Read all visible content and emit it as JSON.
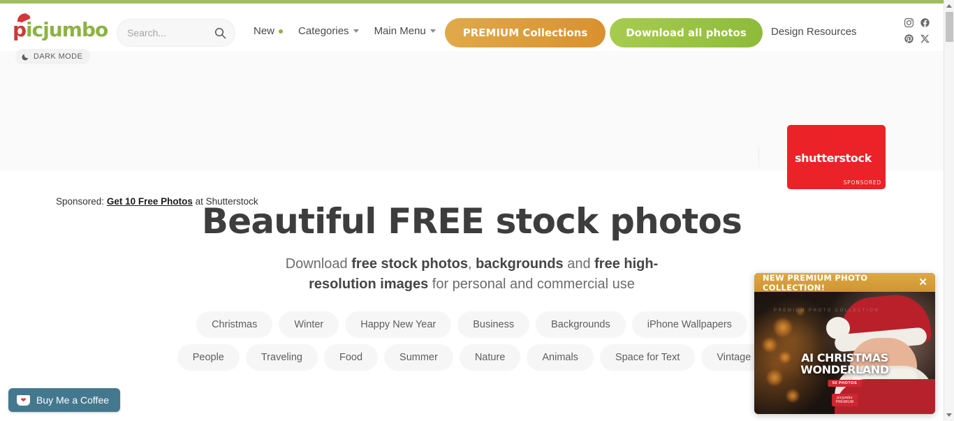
{
  "site": {
    "logo_text_first": "p",
    "logo_text_rest": "icjumbo",
    "accent_green": "#8cb342",
    "accent_gold": "#d9912f",
    "accent_red": "#eb2227"
  },
  "header": {
    "search": {
      "placeholder": "Search...",
      "value": "",
      "icon": "search-icon"
    },
    "nav": [
      {
        "label": "New",
        "badge": "green-dot",
        "has_caret": false
      },
      {
        "label": "Categories",
        "badge": "",
        "has_caret": true
      },
      {
        "label": "Main Menu",
        "badge": "",
        "has_caret": true
      }
    ],
    "premium_button": "PREMIUM Collections",
    "download_button": "Download all photos",
    "design_resources": "Design Resources",
    "socials": [
      {
        "name": "instagram-icon",
        "glyph": "instagram"
      },
      {
        "name": "facebook-icon",
        "glyph": "facebook"
      },
      {
        "name": "pinterest-icon",
        "glyph": "pinterest"
      },
      {
        "name": "x-twitter-icon",
        "glyph": "x"
      }
    ],
    "dark_mode_label": "DARK MODE",
    "dark_mode_icon": "moon-icon"
  },
  "sponsored": {
    "ad_logo": "shutterstock",
    "ad_logo_suffix": "·",
    "ad_sponsored_label": "SPONSORED",
    "line_prefix": "Sponsored: ",
    "line_link": "Get 10 Free Photos",
    "line_suffix": " at Shutterstock"
  },
  "hero": {
    "title": "Beautiful FREE stock photos",
    "subtitle_parts": [
      {
        "text": "Download ",
        "bold": false
      },
      {
        "text": "free stock photos",
        "bold": true
      },
      {
        "text": ", ",
        "bold": false
      },
      {
        "text": "backgrounds",
        "bold": true
      },
      {
        "text": " and ",
        "bold": false
      },
      {
        "text": "free high-resolution images",
        "bold": true
      },
      {
        "text": " for personal and commercial use",
        "bold": false
      }
    ],
    "tags_row1": [
      "Christmas",
      "Winter",
      "Happy New Year",
      "Business",
      "Backgrounds",
      "iPhone Wallpapers"
    ],
    "tags_row2": [
      "People",
      "Traveling",
      "Food",
      "Summer",
      "Nature",
      "Animals",
      "Space for Text",
      "Vintage"
    ]
  },
  "buy_me_a_coffee": {
    "label": "Buy Me a Coffee",
    "icon": "coffee-cup-icon",
    "background": "#44788f"
  },
  "promo_popup": {
    "header_title": "NEW PREMIUM PHOTO COLLECTION!",
    "close_label": "✕",
    "image_headline_line1": "AI CHRISTMAS",
    "image_headline_line2": "WONDERLAND",
    "image_badge": "50 PHOTOS",
    "image_brand_line1": "picjumbo",
    "image_brand_line2": "PREMIUM",
    "image_faint_text": "PREMIUM PHOTO COLLECTION",
    "header_color": "#d9a43c"
  },
  "scrollbar": {
    "up_arrow": "scroll-up-arrow",
    "down_arrow": "scroll-down-arrow",
    "thumb": "scroll-thumb"
  }
}
